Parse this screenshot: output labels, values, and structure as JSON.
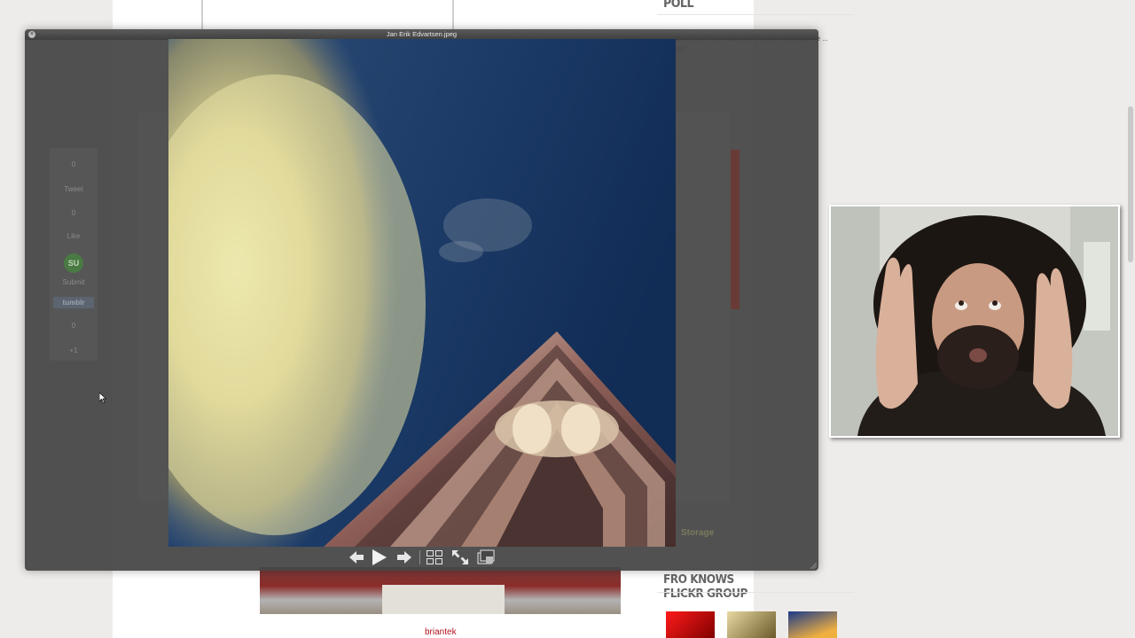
{
  "quicklook": {
    "title": "Jan Erik Edvartsen.jpeg",
    "close_icon": "close-icon"
  },
  "sidebar": {
    "poll_heading": "POLL",
    "poll_question": "Are you on the FroKnowsPhoto Email list to get the ... content?",
    "flickr_heading": "FRO KNOWS FLICKR GROUP"
  },
  "post": {
    "author": "briantek"
  },
  "share_ghost": {
    "count_top": "0",
    "tweet": "Tweet",
    "like_count": "0",
    "like": "Like",
    "stumble": "Submit",
    "tumblr": "tumblr",
    "count_bottom": "0",
    "plus": "+1",
    "su": "SU"
  },
  "ghost_storage": "Storage",
  "controls": {
    "prev": "previous",
    "play": "play",
    "next": "next",
    "grid": "index-sheet",
    "fullscreen": "full-screen",
    "iphoto": "add-to-iphoto"
  },
  "colors": {
    "overlay": "#464646",
    "sky": "#24456d",
    "accent_red": "#b3121c"
  }
}
